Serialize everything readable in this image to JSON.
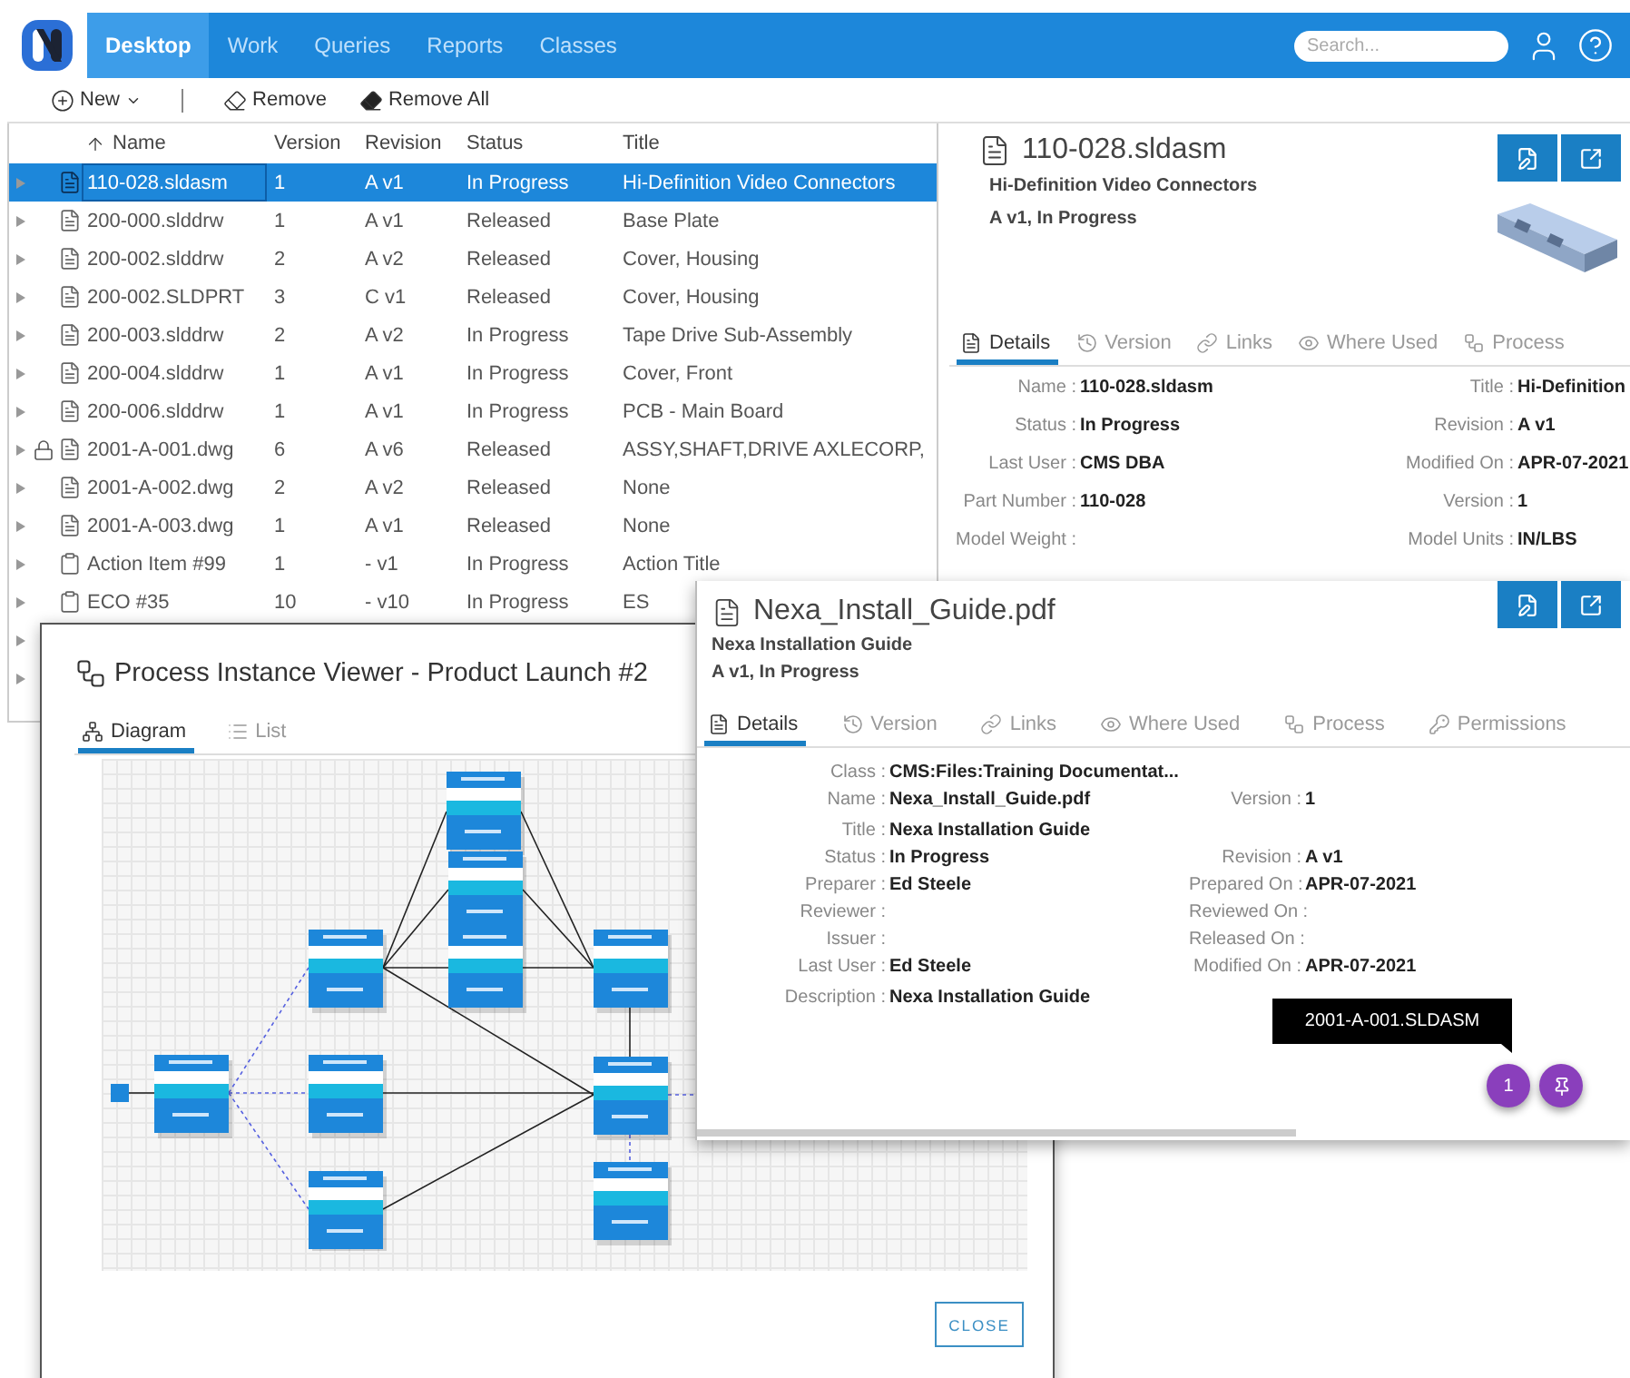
{
  "nav": {
    "tabs": [
      {
        "label": "Desktop",
        "selected": true
      },
      {
        "label": "Work",
        "selected": false
      },
      {
        "label": "Queries",
        "selected": false
      },
      {
        "label": "Reports",
        "selected": false
      },
      {
        "label": "Classes",
        "selected": false
      }
    ],
    "search": {
      "placeholder": "Search..."
    }
  },
  "toolbar": [
    {
      "kind": "new",
      "label": "New"
    },
    {
      "kind": "remove",
      "label": "Remove"
    },
    {
      "kind": "remove_all",
      "label": "Remove All"
    }
  ],
  "table": {
    "columns": [
      {
        "label": "Name",
        "sorted": true
      },
      {
        "label": "Version",
        "sorted": false
      },
      {
        "label": "Revision",
        "sorted": false
      },
      {
        "label": "Status",
        "sorted": false
      },
      {
        "label": "Title",
        "sorted": false
      }
    ],
    "rows": [
      {
        "kind": "document",
        "locked": false,
        "selected": true,
        "name": "110-028.sldasm",
        "version": "1",
        "revision": "A v1",
        "status": "In Progress",
        "title": "Hi-Definition Video Connectors"
      },
      {
        "kind": "document",
        "locked": false,
        "selected": false,
        "name": "200-000.slddrw",
        "version": "1",
        "revision": "A v1",
        "status": "Released",
        "title": "Base Plate"
      },
      {
        "kind": "document",
        "locked": false,
        "selected": false,
        "name": "200-002.slddrw",
        "version": "2",
        "revision": "A v2",
        "status": "Released",
        "title": "Cover, Housing"
      },
      {
        "kind": "document",
        "locked": false,
        "selected": false,
        "name": "200-002.SLDPRT",
        "version": "3",
        "revision": "C v1",
        "status": "Released",
        "title": "Cover, Housing"
      },
      {
        "kind": "document",
        "locked": false,
        "selected": false,
        "name": "200-003.slddrw",
        "version": "2",
        "revision": "A v2",
        "status": "In Progress",
        "title": "Tape Drive Sub-Assembly"
      },
      {
        "kind": "document",
        "locked": false,
        "selected": false,
        "name": "200-004.slddrw",
        "version": "1",
        "revision": "A v1",
        "status": "In Progress",
        "title": "Cover, Front"
      },
      {
        "kind": "document",
        "locked": false,
        "selected": false,
        "name": "200-006.slddrw",
        "version": "1",
        "revision": "A v1",
        "status": "In Progress",
        "title": "PCB - Main Board"
      },
      {
        "kind": "document",
        "locked": true,
        "selected": false,
        "name": "2001-A-001.dwg",
        "version": "6",
        "revision": "A v6",
        "status": "Released",
        "title": "ASSY,SHAFT,DRIVE AXLECORP,"
      },
      {
        "kind": "document",
        "locked": false,
        "selected": false,
        "name": "2001-A-002.dwg",
        "version": "2",
        "revision": "A v2",
        "status": "Released",
        "title": "None"
      },
      {
        "kind": "document",
        "locked": false,
        "selected": false,
        "name": "2001-A-003.dwg",
        "version": "1",
        "revision": "A v1",
        "status": "Released",
        "title": "None"
      },
      {
        "kind": "form",
        "locked": false,
        "selected": false,
        "name": "Action Item #99",
        "version": "1",
        "revision": "- v1",
        "status": "In Progress",
        "title": "Action Title"
      },
      {
        "kind": "form",
        "locked": false,
        "selected": false,
        "name": "ECO #35",
        "version": "10",
        "revision": "- v10",
        "status": "In Progress",
        "title": "ES"
      }
    ]
  },
  "detail": {
    "name": "110-028.sldasm",
    "title": "Hi-Definition Video Connectors",
    "state": "A v1, In Progress",
    "tabs": [
      {
        "kind": "details",
        "label": "Details",
        "selected": true
      },
      {
        "kind": "version",
        "label": "Version",
        "selected": false
      },
      {
        "kind": "links",
        "label": "Links",
        "selected": false
      },
      {
        "kind": "where_used",
        "label": "Where Used",
        "selected": false
      },
      {
        "kind": "process",
        "label": "Process",
        "selected": false
      }
    ],
    "fields": [
      {
        "left": {
          "label": "Name :",
          "value": "110-028.sldasm"
        },
        "right": {
          "label": "Title :",
          "value": "Hi-Definition"
        }
      },
      {
        "left": {
          "label": "Status :",
          "value": "In Progress"
        },
        "right": {
          "label": "Revision :",
          "value": "A v1"
        }
      },
      {
        "left": {
          "label": "Last User :",
          "value": "CMS DBA"
        },
        "right": {
          "label": "Modified On :",
          "value": "APR-07-2021"
        }
      },
      {
        "left": {
          "label": "Part Number :",
          "value": "110-028"
        },
        "right": {
          "label": "Version :",
          "value": "1"
        }
      },
      {
        "left": {
          "label": "Model Weight :"
        },
        "right": {
          "label": "Model Units :",
          "value": "IN/LBS"
        }
      }
    ]
  },
  "process_viewer": {
    "title": "Process Instance Viewer - Product Launch #2",
    "tabs": [
      {
        "kind": "diagram",
        "label": "Diagram",
        "selected": true
      },
      {
        "kind": "list",
        "label": "List",
        "selected": false
      }
    ],
    "close_button": "CLOSE"
  },
  "file_panel": {
    "name": "Nexa_Install_Guide.pdf",
    "title": "Nexa Installation Guide",
    "state": "A v1, In Progress",
    "tabs": [
      {
        "kind": "details",
        "label": "Details",
        "selected": true
      },
      {
        "kind": "version",
        "label": "Version",
        "selected": false
      },
      {
        "kind": "links",
        "label": "Links",
        "selected": false
      },
      {
        "kind": "where_used",
        "label": "Where Used",
        "selected": false
      },
      {
        "kind": "process",
        "label": "Process",
        "selected": false
      },
      {
        "kind": "permissions",
        "label": "Permissions",
        "selected": false
      }
    ],
    "fields": [
      {
        "left": {
          "label": "Class :",
          "value": "CMS:Files:Training Documentat..."
        }
      },
      {
        "left": {
          "label": "Name :",
          "value": "Nexa_Install_Guide.pdf"
        },
        "right": {
          "label": "Version :",
          "value": "1"
        }
      },
      {
        "left": {
          "label": "Title :",
          "value": "Nexa Installation Guide"
        }
      },
      {
        "left": {
          "label": "Status :",
          "value": "In Progress"
        },
        "right": {
          "label": "Revision :",
          "value": "A v1"
        }
      },
      {
        "left": {
          "label": "Preparer :",
          "value": "Ed Steele"
        },
        "right": {
          "label": "Prepared On :",
          "value": "APR-07-2021"
        }
      },
      {
        "left": {
          "label": "Reviewer :"
        },
        "right": {
          "label": "Reviewed On :"
        }
      },
      {
        "left": {
          "label": "Issuer :"
        },
        "right": {
          "label": "Released On :"
        }
      },
      {
        "left": {
          "label": "Last User :",
          "value": "Ed Steele"
        },
        "right": {
          "label": "Modified On :",
          "value": "APR-07-2021"
        }
      },
      {
        "left": {
          "label": "Description :",
          "value": "Nexa Installation Guide"
        }
      }
    ],
    "tooltip": "2001-A-001.SLDASM",
    "badge": "1"
  }
}
